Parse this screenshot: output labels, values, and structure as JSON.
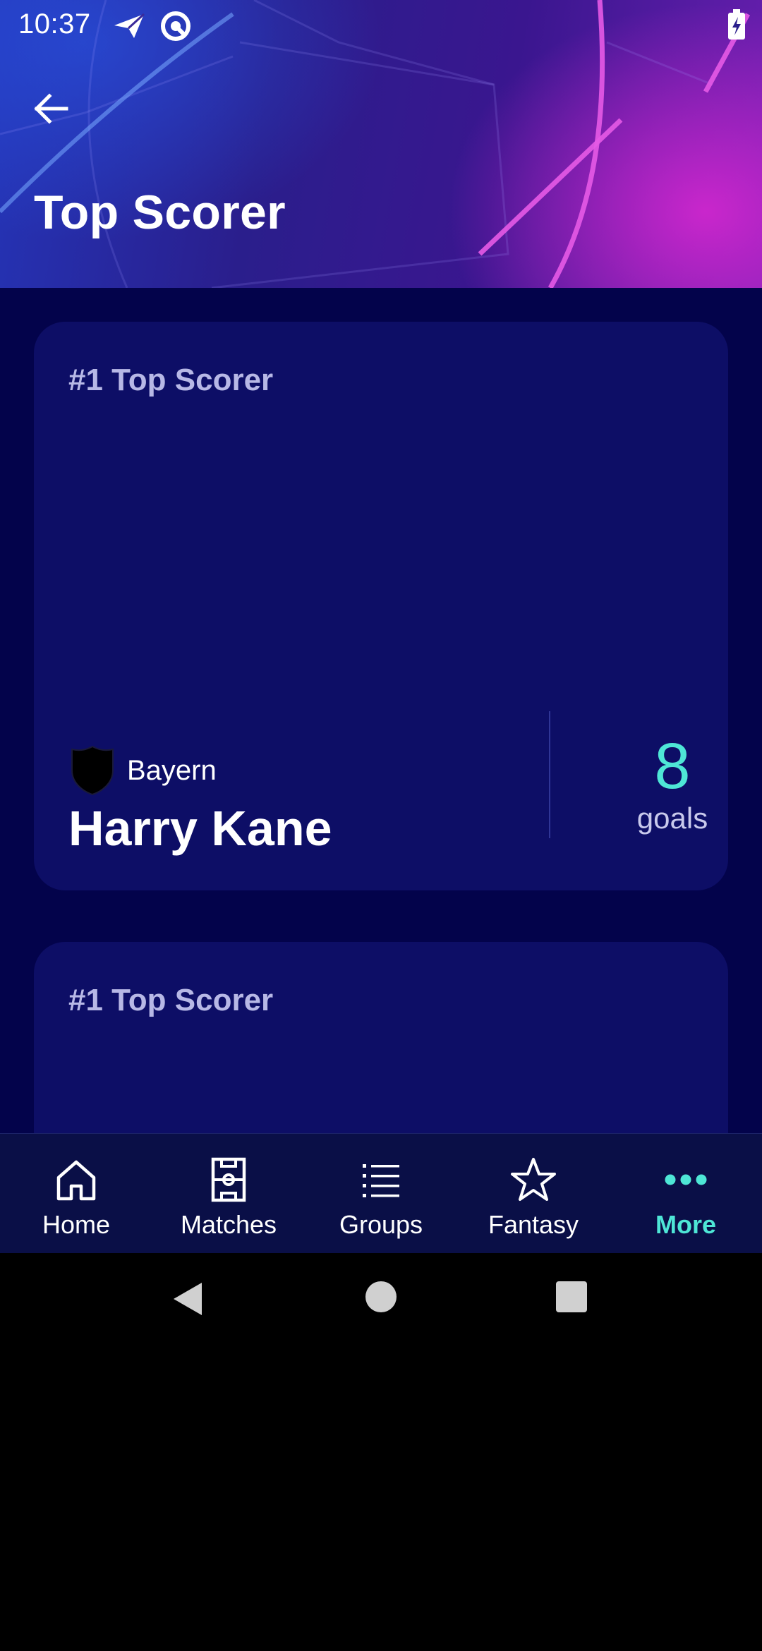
{
  "status_bar": {
    "time": "10:37"
  },
  "header": {
    "title": "Top Scorer",
    "back_icon": "arrow-left-icon"
  },
  "cards": [
    {
      "heading": "#1 Top Scorer",
      "club": "Bayern",
      "player": "Harry Kane",
      "goals": "8",
      "goals_label": "goals"
    },
    {
      "heading": "#1 Top Scorer"
    }
  ],
  "bottom_nav": {
    "items": [
      {
        "label": "Home",
        "icon": "home-icon"
      },
      {
        "label": "Matches",
        "icon": "pitch-icon"
      },
      {
        "label": "Groups",
        "icon": "list-icon"
      },
      {
        "label": "Fantasy",
        "icon": "star-icon"
      },
      {
        "label": "More",
        "icon": "more-dots-icon",
        "active": true
      }
    ]
  },
  "colors": {
    "accent": "#4ee6d6",
    "card_bg": "#0d0e66",
    "page_bg": "#03034b",
    "nav_bg": "#0a0f47"
  }
}
